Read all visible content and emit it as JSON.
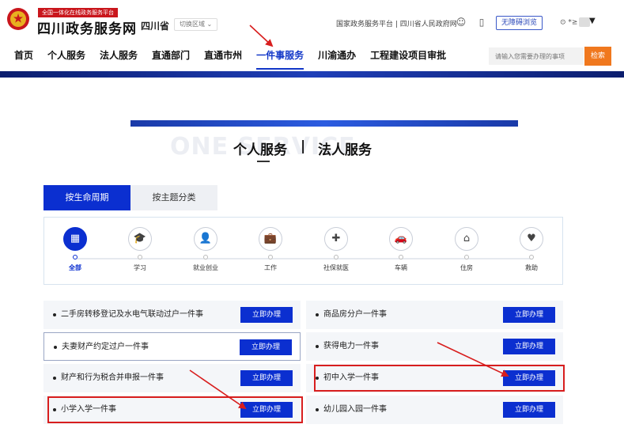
{
  "header": {
    "brand_tag": "全国一体化在线政务服务平台",
    "brand_name": "四川政务服务网",
    "province": "四川省",
    "switch_region": "切换区域",
    "switch_region_chevron": "⌄",
    "top_links": "国家政务服务平台 | 四川省人民政府网",
    "accessible_label": "无障碍浏览",
    "user_prefix": "⊙ *≥",
    "caret": "▼"
  },
  "nav": {
    "items": [
      "首页",
      "个人服务",
      "法人服务",
      "直通部门",
      "直通市州",
      "一件事服务",
      "川渝通办",
      "工程建设项目审批"
    ],
    "active_index": 5,
    "search_placeholder": "请输入您需要办理的事项",
    "search_button": "检索"
  },
  "banner": {
    "bg_text": "ONE          SERVICE",
    "title_left": "个人服务",
    "separator": "|",
    "title_right": "法人服务"
  },
  "tabs": {
    "active": "按生命周期",
    "inactive": "按主题分类"
  },
  "stages": [
    {
      "label": "全部",
      "icon": "grid-icon",
      "glyph": "▦"
    },
    {
      "label": "学习",
      "icon": "graduation-cap-icon",
      "glyph": "🎓"
    },
    {
      "label": "就业创业",
      "icon": "person-icon",
      "glyph": "👤"
    },
    {
      "label": "工作",
      "icon": "briefcase-icon",
      "glyph": "💼"
    },
    {
      "label": "社保就医",
      "icon": "medical-icon",
      "glyph": "✚"
    },
    {
      "label": "车辆",
      "icon": "car-icon",
      "glyph": "🚗"
    },
    {
      "label": "住房",
      "icon": "house-icon",
      "glyph": "⌂"
    },
    {
      "label": "救助",
      "icon": "heart-hand-icon",
      "glyph": "♥"
    }
  ],
  "items_left": [
    "二手房转移登记及水电气联动过户一件事",
    "夫妻财产约定过户一件事",
    "财产和行为税合并申报一件事",
    "小学入学一件事"
  ],
  "items_right": [
    "商品房分户一件事",
    "获得电力一件事",
    "初中入学一件事",
    "幼儿园入园一件事"
  ],
  "handle_button": "立即办理",
  "colors": {
    "primary": "#0b2fd0",
    "brand_red": "#c9161c",
    "search_orange": "#f0781e",
    "annotation_red": "#d81e1e"
  }
}
